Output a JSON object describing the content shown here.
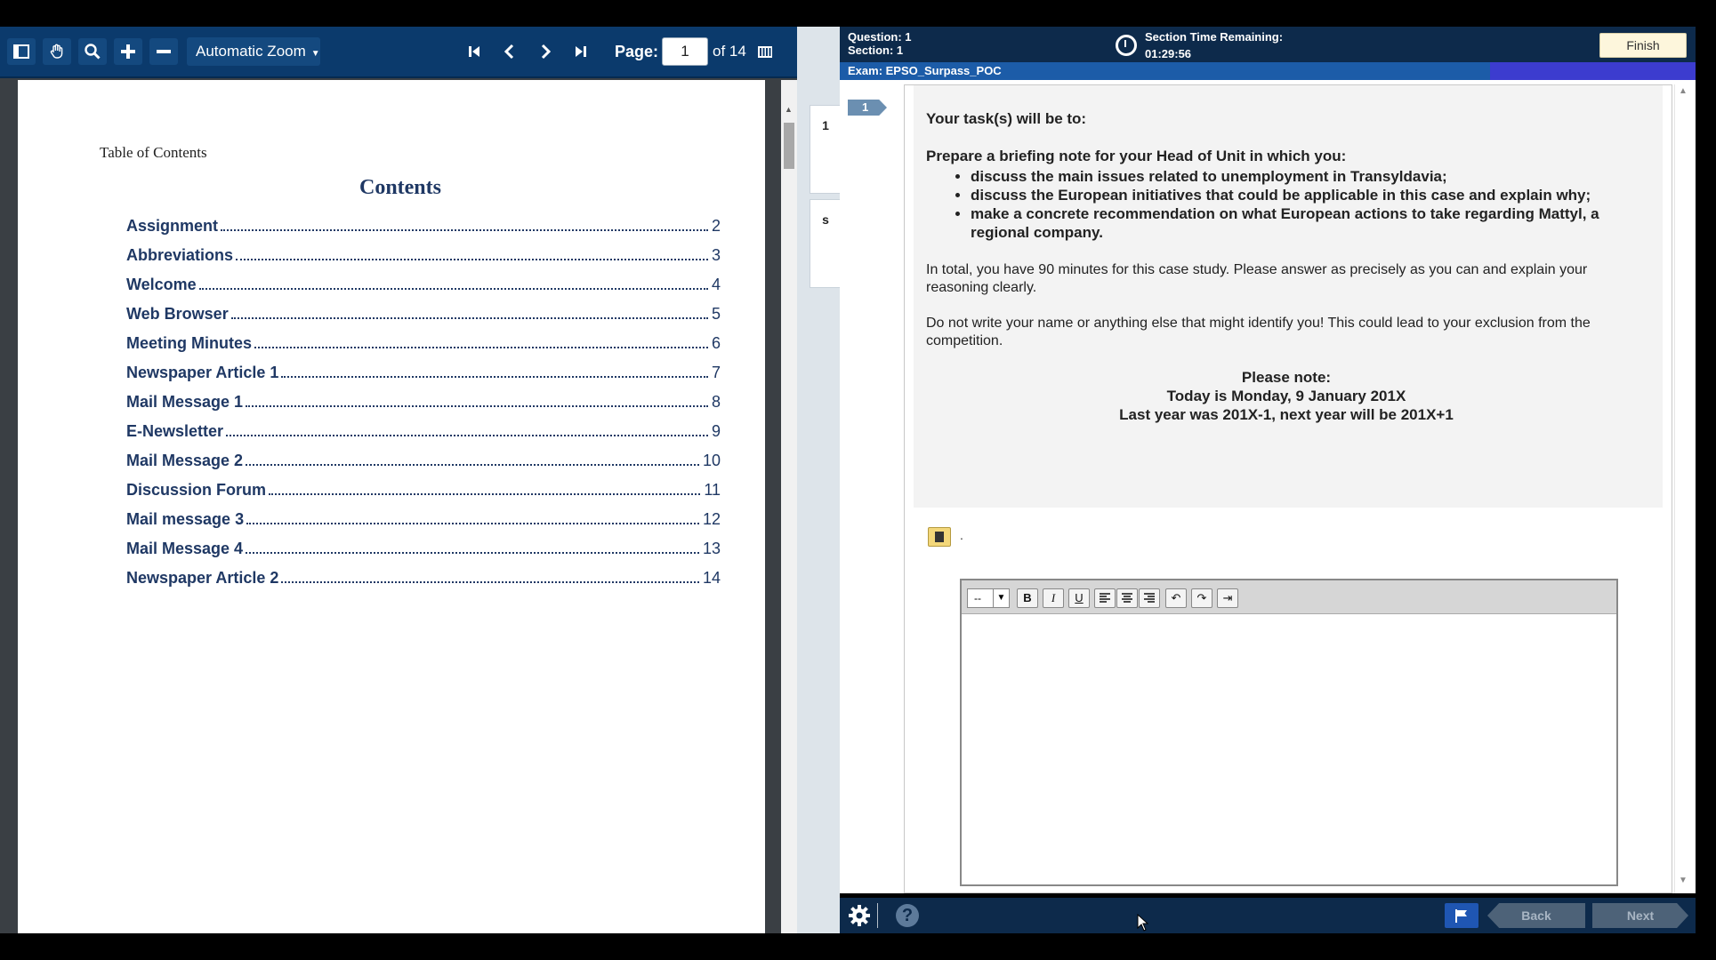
{
  "pdf_viewer": {
    "zoom_label": "Automatic Zoom",
    "page_label": "Page:",
    "current_page": "1",
    "page_of": "of 14",
    "toc_heading_small": "Table of Contents",
    "toc_title": "Contents",
    "toc": [
      {
        "title": "Assignment",
        "page": "2"
      },
      {
        "title": "Abbreviations",
        "page": "3"
      },
      {
        "title": "Welcome",
        "page": "4"
      },
      {
        "title": "Web Browser",
        "page": "5"
      },
      {
        "title": "Meeting Minutes",
        "page": "6"
      },
      {
        "title": "Newspaper Article 1",
        "page": "7"
      },
      {
        "title": "Mail Message 1",
        "page": "8"
      },
      {
        "title": "E-Newsletter",
        "page": "9"
      },
      {
        "title": "Mail Message 2",
        "page": "10"
      },
      {
        "title": "Discussion Forum",
        "page": "11"
      },
      {
        "title": "Mail message 3",
        "page": "12"
      },
      {
        "title": "Mail Message 4",
        "page": "13"
      },
      {
        "title": "Newspaper Article 2",
        "page": "14"
      }
    ]
  },
  "exam": {
    "side_tabs": [
      "1",
      "s"
    ],
    "question_label": "Question: 1",
    "section_label": "Section: 1",
    "timer_label": "Section Time Remaining:",
    "timer_value": "01:29:56",
    "finish_label": "Finish",
    "exam_name": "Exam: EPSO_Surpass_POC",
    "progress_fraction": 0.24,
    "question_number": "1",
    "intro": "Your task(s) will be to:",
    "prepare": "Prepare a briefing note for your Head of Unit in which you:",
    "bullets": [
      "discuss the main issues related to unemployment in Transyldavia;",
      "discuss the European initiatives that could be applicable in this case and explain why;",
      "make a concrete recommendation on what European actions to take regarding Mattyl, a regional company."
    ],
    "para_time": "In total, you have 90 minutes for this case study. Please answer as precisely as you can and explain your reasoning clearly.",
    "para_name": "Do not write your name or anything else that might identify you! This could lead to your exclusion from the competition.",
    "note_title": "Please note:",
    "note_today": "Today is Monday, 9 January 201X",
    "note_years": "Last year was 201X-1, next year will be 201X+1",
    "dot": ".",
    "editor": {
      "font_value": "--",
      "bold": "B",
      "italic": "I",
      "underline": "U"
    },
    "footer": {
      "help": "?",
      "back_label": "Back",
      "next_label": "Next"
    }
  },
  "colors": {
    "toolbar_bg": "#0b3a6c",
    "exam_header_bg": "#0d2a4b",
    "exam_bar_bg": "#1c5ca8",
    "toc_text": "#1f3864"
  }
}
